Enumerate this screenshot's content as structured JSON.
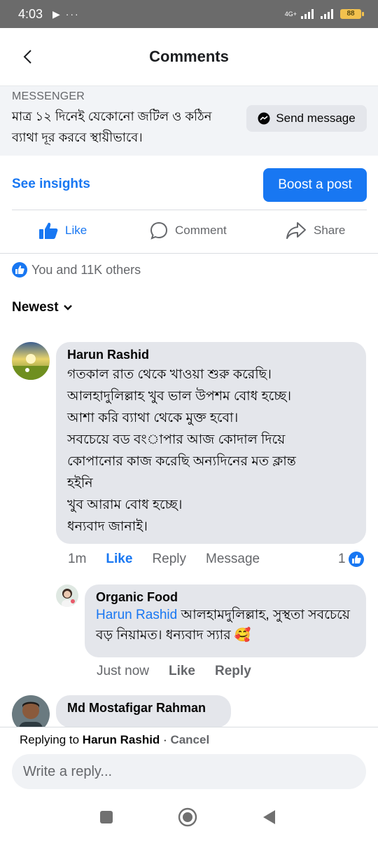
{
  "status_bar": {
    "time": "4:03",
    "notif_icons": "▶ ···",
    "network": "4G+",
    "battery": "88"
  },
  "header": {
    "title": "Comments"
  },
  "post": {
    "source_label": "MESSENGER",
    "text": "মাত্র ১২ দিনেই যেকোনো জটিল ও কঠিন ব্যাথা দূর করবে স্থায়ীভাবে।",
    "send_message_label": "Send message"
  },
  "insights": {
    "see_insights_label": "See insights",
    "boost_label": "Boost a post"
  },
  "actions": {
    "like_label": "Like",
    "comment_label": "Comment",
    "share_label": "Share"
  },
  "reactions": {
    "summary": "You and 11K others"
  },
  "sort": {
    "label": "Newest"
  },
  "comments": [
    {
      "author": "Harun Rashid",
      "lines": [
        "গতকাল রাত থেকে খাওয়া শুরু করেছি।",
        "আলহাদুলিল্লাহ  খুব ভাল উপশম বোধ হচ্ছে।",
        "আশা করি ব্যাথা থেকে মুক্ত হবো।",
        "সবচেয়ে বড বংাপার আজ কোদাল দিয়ে",
        "কোপানোর কাজ করেছি অন্যদিনের মত ক্লান্ত",
        "হইনি",
        "খুব আরাম বোধ হচ্ছে।",
        "ধন্যবাদ জানাই।"
      ],
      "time": "1m",
      "like_label": "Like",
      "reply_label": "Reply",
      "message_label": "Message",
      "like_count": "1"
    },
    {
      "author": "Organic Food",
      "mention": "Harun Rashid",
      "text": "আলহামদুলিল্লাহ, সুস্থতা সবচেয়ে বড় নিয়ামত। ধন্যবাদ স্যার 🥰",
      "time": "Just now",
      "like_label": "Like",
      "reply_label": "Reply"
    },
    {
      "author": "Md Mostafigar Rahman"
    }
  ],
  "reply_bar": {
    "replying_prefix": "Replying to",
    "replying_to": "Harun Rashid",
    "separator": " · ",
    "cancel_label": "Cancel",
    "placeholder": "Write a reply..."
  },
  "colors": {
    "accent": "#1877f2",
    "bubble": "#e4e6eb",
    "status_bar": "#6b6b6b"
  }
}
